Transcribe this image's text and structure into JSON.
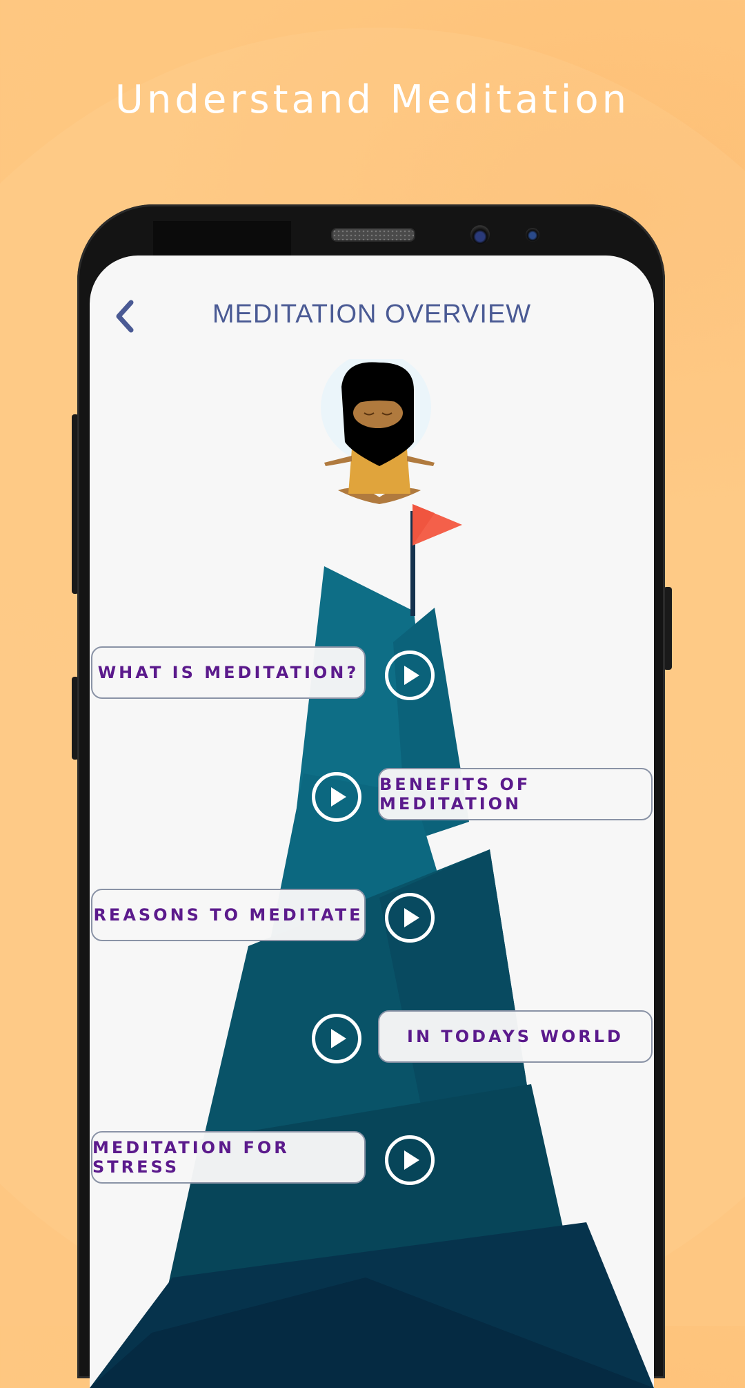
{
  "promo": {
    "title": "Understand Meditation",
    "background_color": "#fec27c"
  },
  "screen": {
    "header": {
      "back_icon": "chevron-left-icon",
      "title": "MEDITATION OVERVIEW",
      "title_color": "#4a5a94"
    },
    "illustration": {
      "character": "meditating-caveman",
      "flag_color": "#f4604a",
      "mountain_colors": [
        "#0e6e86",
        "#0a5a72",
        "#084a63",
        "#07384f",
        "#062a42"
      ]
    },
    "topics": [
      {
        "label": "WHAT IS MEDITATION?",
        "side": "left",
        "play_icon": "play-circle-icon"
      },
      {
        "label": "BENEFITS OF MEDITATION",
        "side": "right",
        "play_icon": "play-circle-icon"
      },
      {
        "label": "REASONS TO MEDITATE",
        "side": "left",
        "play_icon": "play-circle-icon"
      },
      {
        "label": "IN TODAYS WORLD",
        "side": "right",
        "play_icon": "play-circle-icon"
      },
      {
        "label": "MEDITATION FOR STRESS",
        "side": "left",
        "play_icon": "play-circle-icon"
      }
    ],
    "topic_text_color": "#5b1a8c"
  }
}
